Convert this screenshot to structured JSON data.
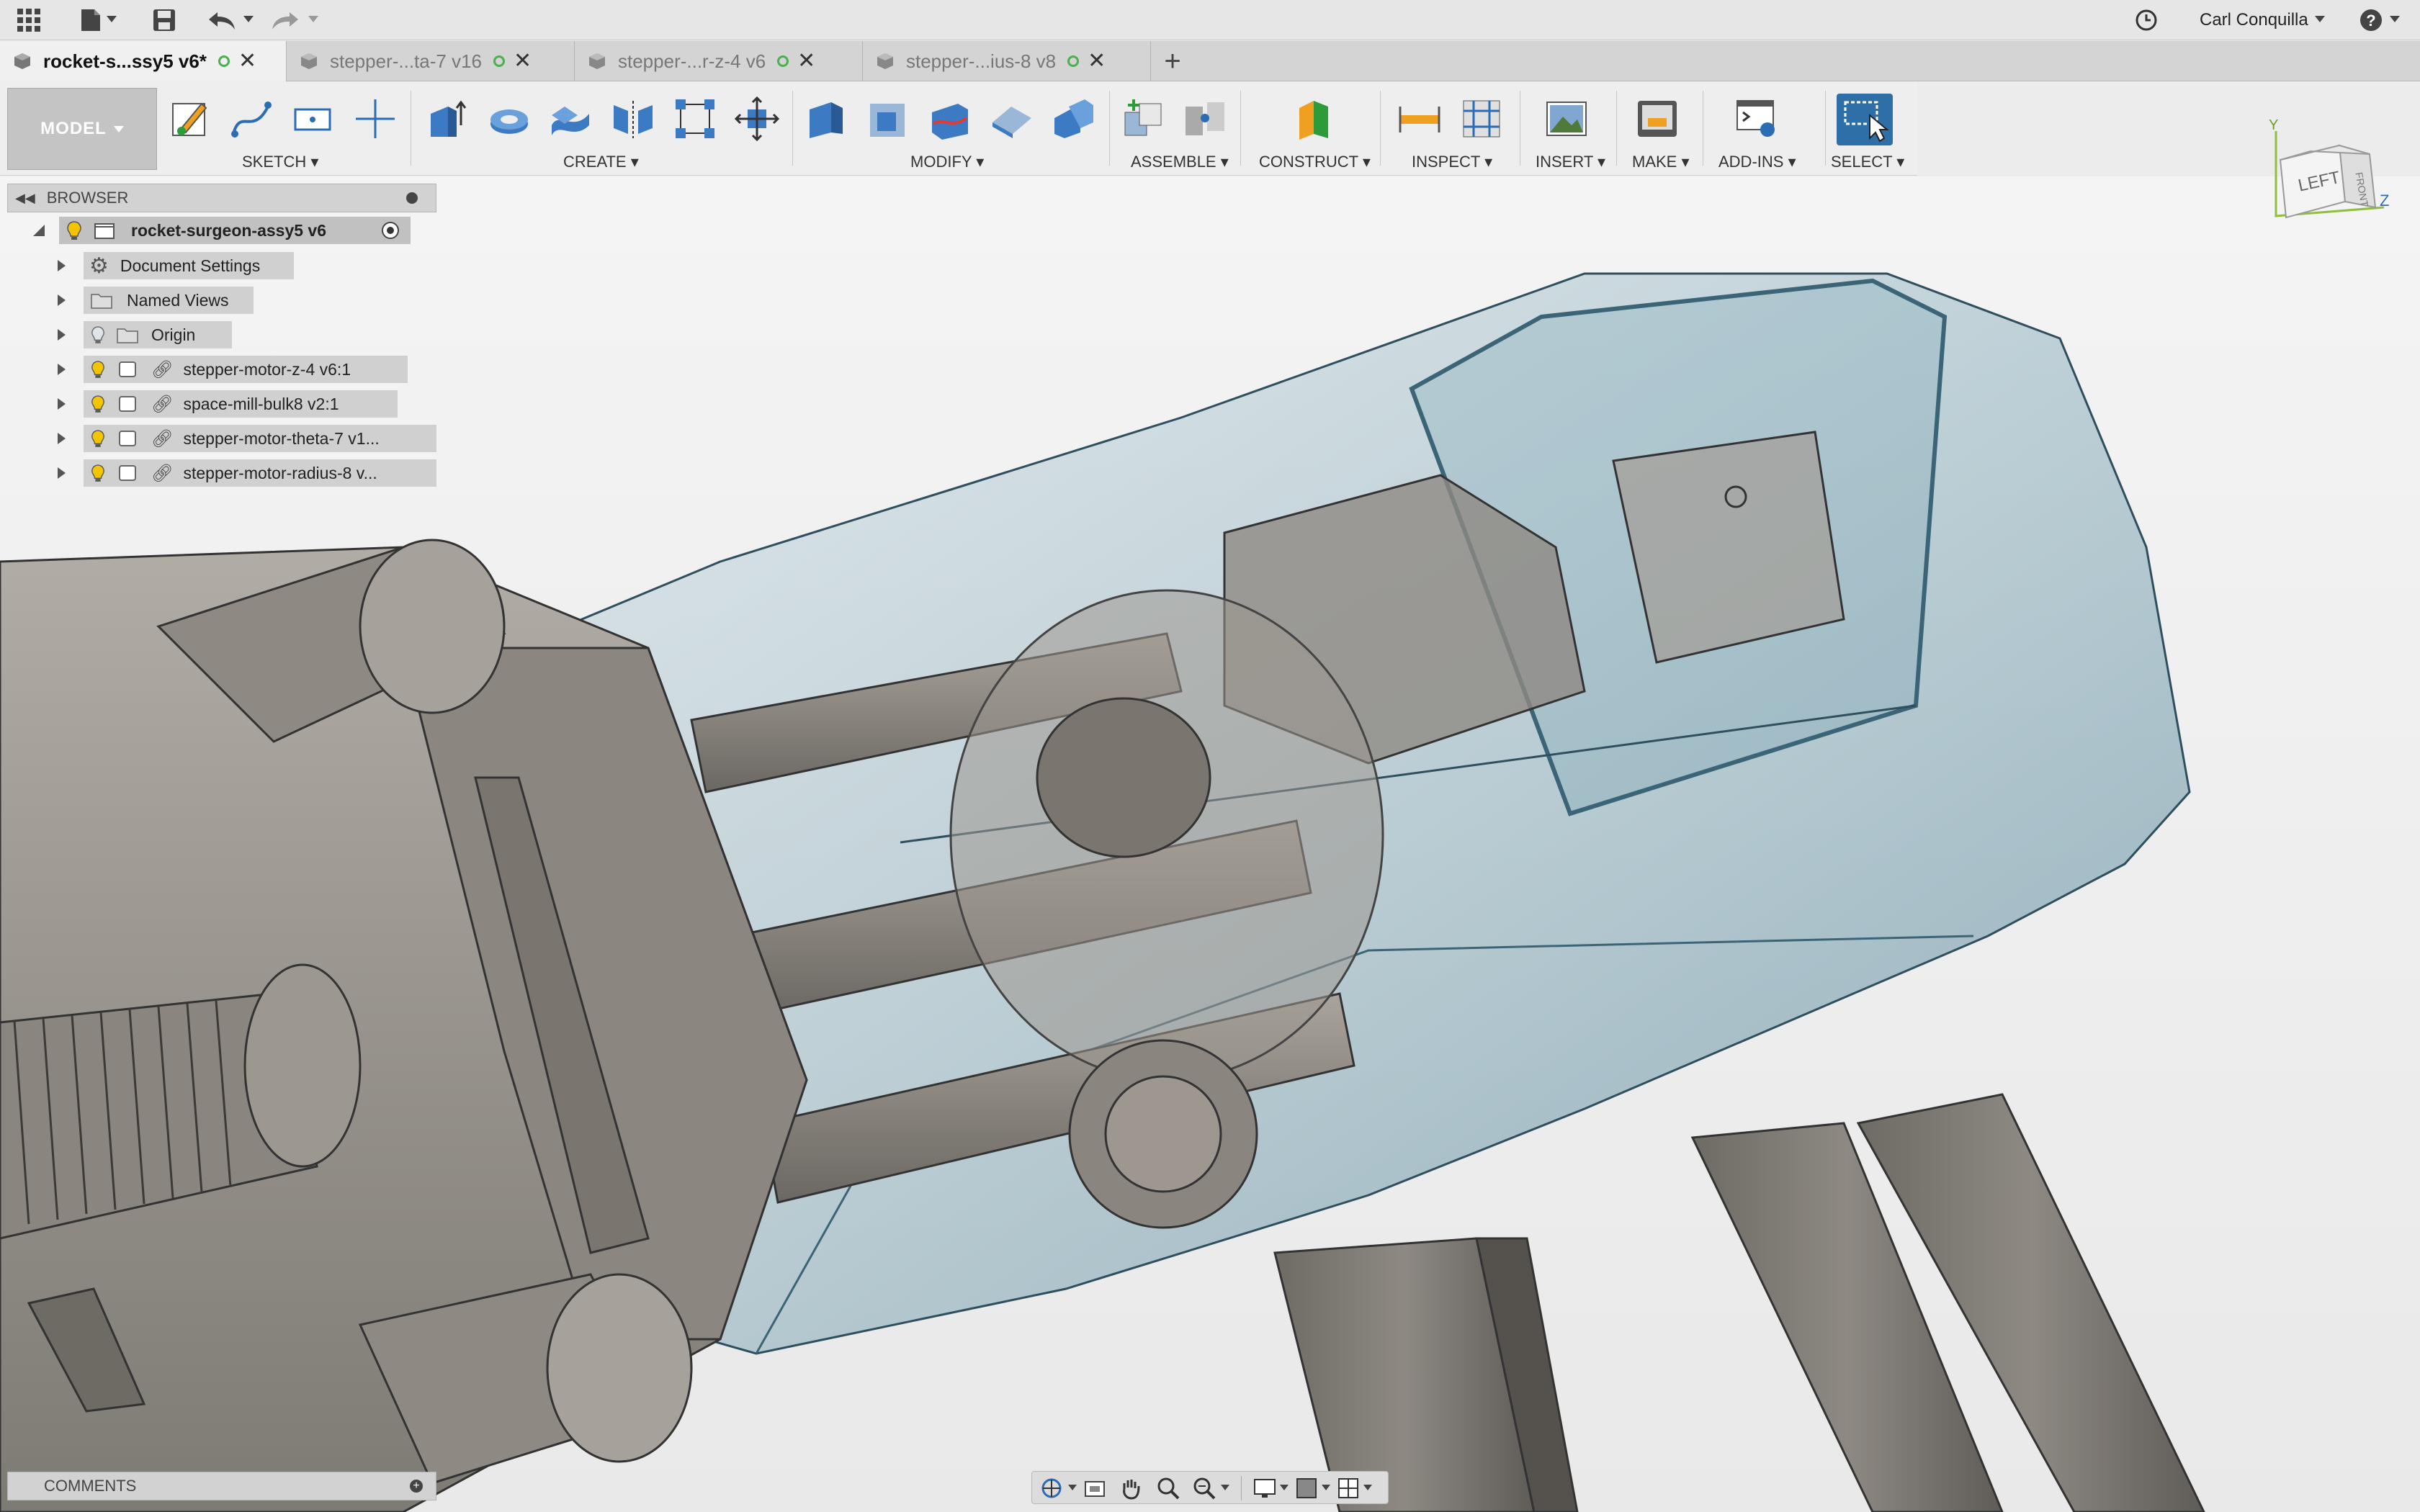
{
  "topbar": {
    "user_name": "Carl Conquilla",
    "icons": [
      "apps-grid-icon",
      "file-menu-icon",
      "save-icon",
      "undo-icon",
      "redo-icon",
      "job-status-icon",
      "help-icon"
    ]
  },
  "tabs": [
    {
      "label": "rocket-s...ssy5 v6*",
      "active": true
    },
    {
      "label": "stepper-...ta-7 v16",
      "active": false
    },
    {
      "label": "stepper-...r-z-4 v6",
      "active": false
    },
    {
      "label": "stepper-...ius-8 v8",
      "active": false
    }
  ],
  "toolbar": {
    "workspace_label": "MODEL",
    "groups": [
      {
        "label": "SKETCH"
      },
      {
        "label": "CREATE"
      },
      {
        "label": "MODIFY"
      },
      {
        "label": "ASSEMBLE"
      },
      {
        "label": "CONSTRUCT"
      },
      {
        "label": "INSPECT"
      },
      {
        "label": "INSERT"
      },
      {
        "label": "MAKE"
      },
      {
        "label": "ADD-INS"
      },
      {
        "label": "SELECT"
      }
    ]
  },
  "browser": {
    "title": "BROWSER",
    "root": "rocket-surgeon-assy5 v6",
    "items": [
      {
        "label": "Document Settings",
        "icon": "gear-icon"
      },
      {
        "label": "Named Views",
        "icon": "folder-icon"
      },
      {
        "label": "Origin",
        "icon": "folder-icon"
      },
      {
        "label": "stepper-motor-z-4 v6:1",
        "icon": "link-icon"
      },
      {
        "label": "space-mill-bulk8 v2:1",
        "icon": "link-icon"
      },
      {
        "label": "stepper-motor-theta-7 v1...",
        "icon": "link-icon"
      },
      {
        "label": "stepper-motor-radius-8 v...",
        "icon": "link-icon"
      }
    ]
  },
  "viewcube": {
    "face_left": "LEFT",
    "face_front": "FRONT",
    "axis_x": "Z",
    "axis_y": "Y"
  },
  "comments": {
    "title": "COMMENTS"
  },
  "colors": {
    "accent": "#2f6fa8",
    "metal": "#8f8a83",
    "housing": "#5d8fa3",
    "background": "#ececec"
  }
}
